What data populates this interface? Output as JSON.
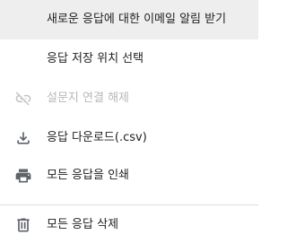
{
  "menu": {
    "items": [
      {
        "label": "새로운 응답에 대한 이메일 알림 받기",
        "icon": "none",
        "enabled": true,
        "highlighted": true
      },
      {
        "label": "응답 저장 위치 선택",
        "icon": "none",
        "enabled": true
      },
      {
        "label": "설문지 연결 해제",
        "icon": "link-off-icon",
        "enabled": false
      },
      {
        "label": "응답 다운로드(.csv)",
        "icon": "download-icon",
        "enabled": true
      },
      {
        "label": "모든 응답을 인쇄",
        "icon": "print-icon",
        "enabled": true
      },
      {
        "label": "모든 응답 삭제",
        "icon": "trash-icon",
        "enabled": true
      }
    ]
  },
  "colors": {
    "highlight_bg": "#eeeeee",
    "text": "#202124",
    "disabled_text": "#b8b8b8",
    "icon": "#5f6368",
    "disabled_icon": "#c4c4c4",
    "divider": "#dadce0",
    "accent": "#673ab7"
  }
}
